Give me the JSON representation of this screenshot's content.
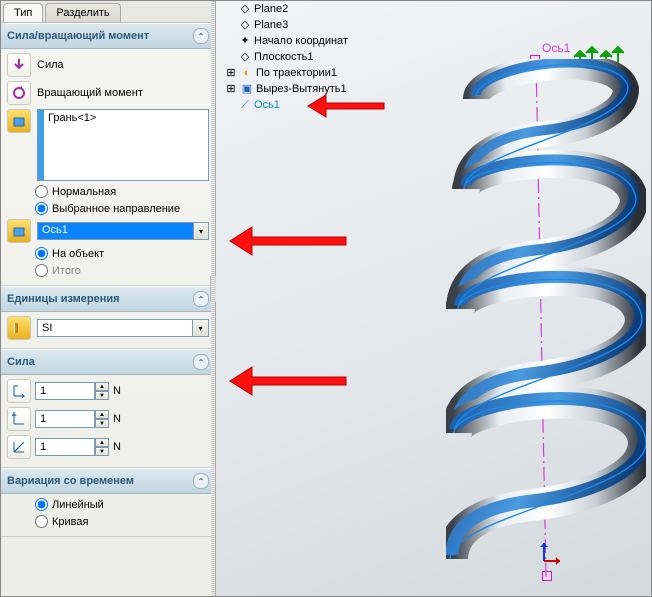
{
  "tabs": {
    "type": "Тип",
    "split": "Разделить"
  },
  "sections": {
    "force_torque": {
      "title": "Сила/вращающий момент"
    },
    "units": {
      "title": "Единицы измерения"
    },
    "force": {
      "title": "Сила"
    },
    "time_var": {
      "title": "Вариация со временем"
    }
  },
  "force_torque": {
    "force_label": "Сила",
    "torque_label": "Вращающий момент",
    "face_selection": "Грань<1>",
    "direction": {
      "normal": "Нормальная",
      "selected": "Выбранное направление",
      "axis_selection": "Ось1",
      "on_object": "На объект",
      "total": "Итого"
    }
  },
  "units": {
    "system": "SI"
  },
  "force": {
    "fx": "1",
    "fy": "1",
    "fz": "1",
    "unit": "N"
  },
  "time_var": {
    "linear": "Линейный",
    "curve": "Кривая"
  },
  "tree": {
    "plane2": "Plane2",
    "plane3": "Plane3",
    "origin": "Начало координат",
    "plane1_ru": "Плоскость1",
    "sweep": "По траектории1",
    "cut_extrude": "Вырез-Вытянуть1",
    "axis1": "Ось1"
  },
  "axis_label_3d": "Ось1"
}
